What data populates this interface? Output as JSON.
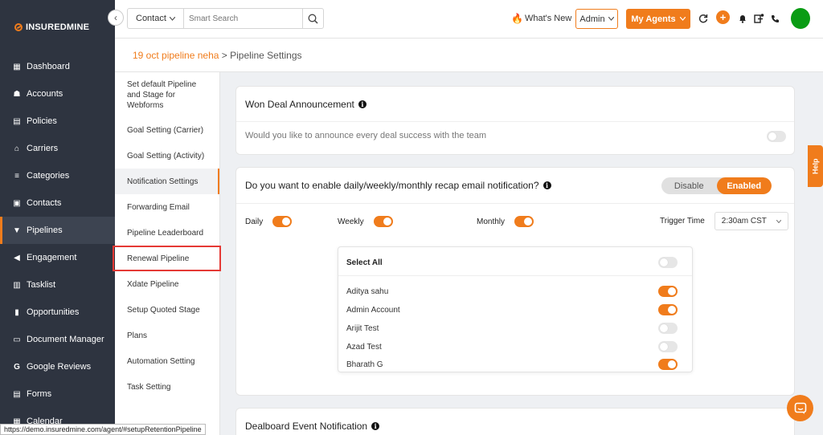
{
  "brand": {
    "name": "INSUREDMINE"
  },
  "sidebar": {
    "collapse_icon": "chevron-left-icon",
    "items": [
      {
        "label": "Dashboard",
        "icon": "dashboard-icon"
      },
      {
        "label": "Accounts",
        "icon": "accounts-icon"
      },
      {
        "label": "Policies",
        "icon": "policies-icon"
      },
      {
        "label": "Carriers",
        "icon": "carriers-icon"
      },
      {
        "label": "Categories",
        "icon": "categories-icon"
      },
      {
        "label": "Contacts",
        "icon": "contacts-icon"
      },
      {
        "label": "Pipelines",
        "icon": "pipelines-icon",
        "active": true
      },
      {
        "label": "Engagement",
        "icon": "megaphone-icon"
      },
      {
        "label": "Tasklist",
        "icon": "tasklist-icon"
      },
      {
        "label": "Opportunities",
        "icon": "opportunities-icon"
      },
      {
        "label": "Document Manager",
        "icon": "folder-icon"
      },
      {
        "label": "Google Reviews",
        "icon": "google-icon"
      },
      {
        "label": "Forms",
        "icon": "forms-icon"
      },
      {
        "label": "Calendar",
        "icon": "calendar-icon"
      }
    ]
  },
  "status_url": "https://demo.insuredmine.com/agent/#setupRetentionPipeline",
  "topbar": {
    "search_type": "Contact",
    "search_placeholder": "Smart Search",
    "whats_new": "What's New",
    "admin_label": "Admin",
    "my_agents_label": "My Agents",
    "plus_label": "+"
  },
  "breadcrumb": {
    "link": "19 oct pipeline neha",
    "separator": " > ",
    "current": "Pipeline Settings"
  },
  "settings_menu": [
    {
      "label": "Set default Pipeline and Stage for Webforms"
    },
    {
      "label": "Goal Setting (Carrier)"
    },
    {
      "label": "Goal Setting (Activity)"
    },
    {
      "label": "Notification Settings",
      "active": true
    },
    {
      "label": "Forwarding Email"
    },
    {
      "label": "Pipeline Leaderboard"
    },
    {
      "label": "Renewal Pipeline",
      "highlighted": true
    },
    {
      "label": "Xdate Pipeline"
    },
    {
      "label": "Setup Quoted Stage"
    },
    {
      "label": "Plans"
    },
    {
      "label": "Automation Setting"
    },
    {
      "label": "Task Setting"
    }
  ],
  "won_deal": {
    "title": "Won Deal Announcement",
    "info": "i",
    "question": "Would you like to announce every deal success with the team",
    "enabled": false
  },
  "recap": {
    "title": "Do you want to enable daily/weekly/monthly recap email notification?",
    "info": "i",
    "disable_label": "Disable",
    "enabled_label": "Enabled",
    "daily_label": "Daily",
    "daily_on": true,
    "weekly_label": "Weekly",
    "weekly_on": true,
    "monthly_label": "Monthly",
    "monthly_on": true,
    "trigger_label": "Trigger Time",
    "trigger_value": "2:30am CST",
    "select_all_label": "Select All",
    "select_all_on": false,
    "agents": [
      {
        "name": "Aditya sahu",
        "on": true
      },
      {
        "name": "Admin Account",
        "on": true
      },
      {
        "name": "Arijit Test",
        "on": false
      },
      {
        "name": "Azad Test",
        "on": false
      },
      {
        "name": "Bharath G",
        "on": true
      }
    ]
  },
  "dealboard": {
    "title": "Dealboard Event Notification",
    "info": "i"
  },
  "help_label": "Help",
  "colors": {
    "accent": "#f07c1c",
    "sidebar_bg": "#2e3440",
    "avatar": "#0a9c14",
    "highlight_border": "#e53935"
  }
}
